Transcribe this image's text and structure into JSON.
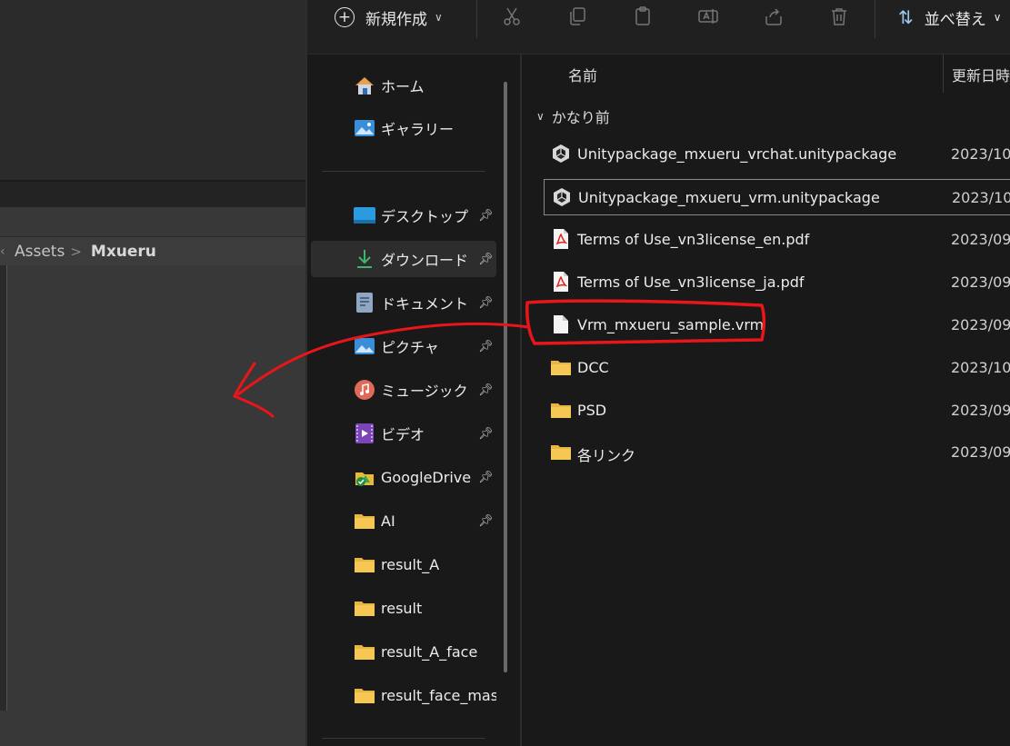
{
  "unity": {
    "breadcrumb": [
      "Assets",
      "Mxueru"
    ]
  },
  "toolbar": {
    "new_label": "新規作成",
    "sort_label": "並べ替え",
    "icons": [
      "cut-icon",
      "copy-icon",
      "paste-icon",
      "rename-icon",
      "share-icon",
      "delete-icon"
    ]
  },
  "nav": {
    "items": [
      {
        "label": "ホーム",
        "icon": "home-icon",
        "pinned": false
      },
      {
        "label": "ギャラリー",
        "icon": "gallery-icon",
        "pinned": false
      },
      {
        "label": "デスクトップ",
        "icon": "desktop-icon",
        "pinned": true
      },
      {
        "label": "ダウンロード",
        "icon": "download-icon",
        "pinned": true,
        "active": true
      },
      {
        "label": "ドキュメント",
        "icon": "document-icon",
        "pinned": true
      },
      {
        "label": "ピクチャ",
        "icon": "pictures-icon",
        "pinned": true
      },
      {
        "label": "ミュージック",
        "icon": "music-icon",
        "pinned": true
      },
      {
        "label": "ビデオ",
        "icon": "video-icon",
        "pinned": true
      },
      {
        "label": "GoogleDrive",
        "icon": "google-drive-icon",
        "pinned": true
      },
      {
        "label": "AI",
        "icon": "folder-icon",
        "pinned": true
      },
      {
        "label": "result_A",
        "icon": "folder-icon",
        "pinned": false
      },
      {
        "label": "result",
        "icon": "folder-icon",
        "pinned": false
      },
      {
        "label": "result_A_face",
        "icon": "folder-icon",
        "pinned": false
      },
      {
        "label": "result_face_mask",
        "icon": "folder-icon",
        "pinned": false
      }
    ]
  },
  "content": {
    "columns": {
      "name": "名前",
      "date": "更新日時"
    },
    "group_label": "かなり前",
    "files": [
      {
        "name": "Unitypackage_mxueru_vrchat.unitypackage",
        "date": "2023/10",
        "icon": "unity-package-icon"
      },
      {
        "name": "Unitypackage_mxueru_vrm.unitypackage",
        "date": "2023/10",
        "icon": "unity-package-icon",
        "focused": true
      },
      {
        "name": "Terms of Use_vn3license_en.pdf",
        "date": "2023/09",
        "icon": "pdf-icon"
      },
      {
        "name": "Terms of Use_vn3license_ja.pdf",
        "date": "2023/09",
        "icon": "pdf-icon"
      },
      {
        "name": "Vrm_mxueru_sample.vrm",
        "date": "2023/09",
        "icon": "file-icon",
        "highlighted": true
      },
      {
        "name": "DCC",
        "date": "2023/10",
        "icon": "folder-icon"
      },
      {
        "name": "PSD",
        "date": "2023/09",
        "icon": "folder-icon"
      },
      {
        "name": "各リンク",
        "date": "2023/09",
        "icon": "folder-icon"
      }
    ]
  },
  "annotation": {
    "color": "#e8161b"
  }
}
